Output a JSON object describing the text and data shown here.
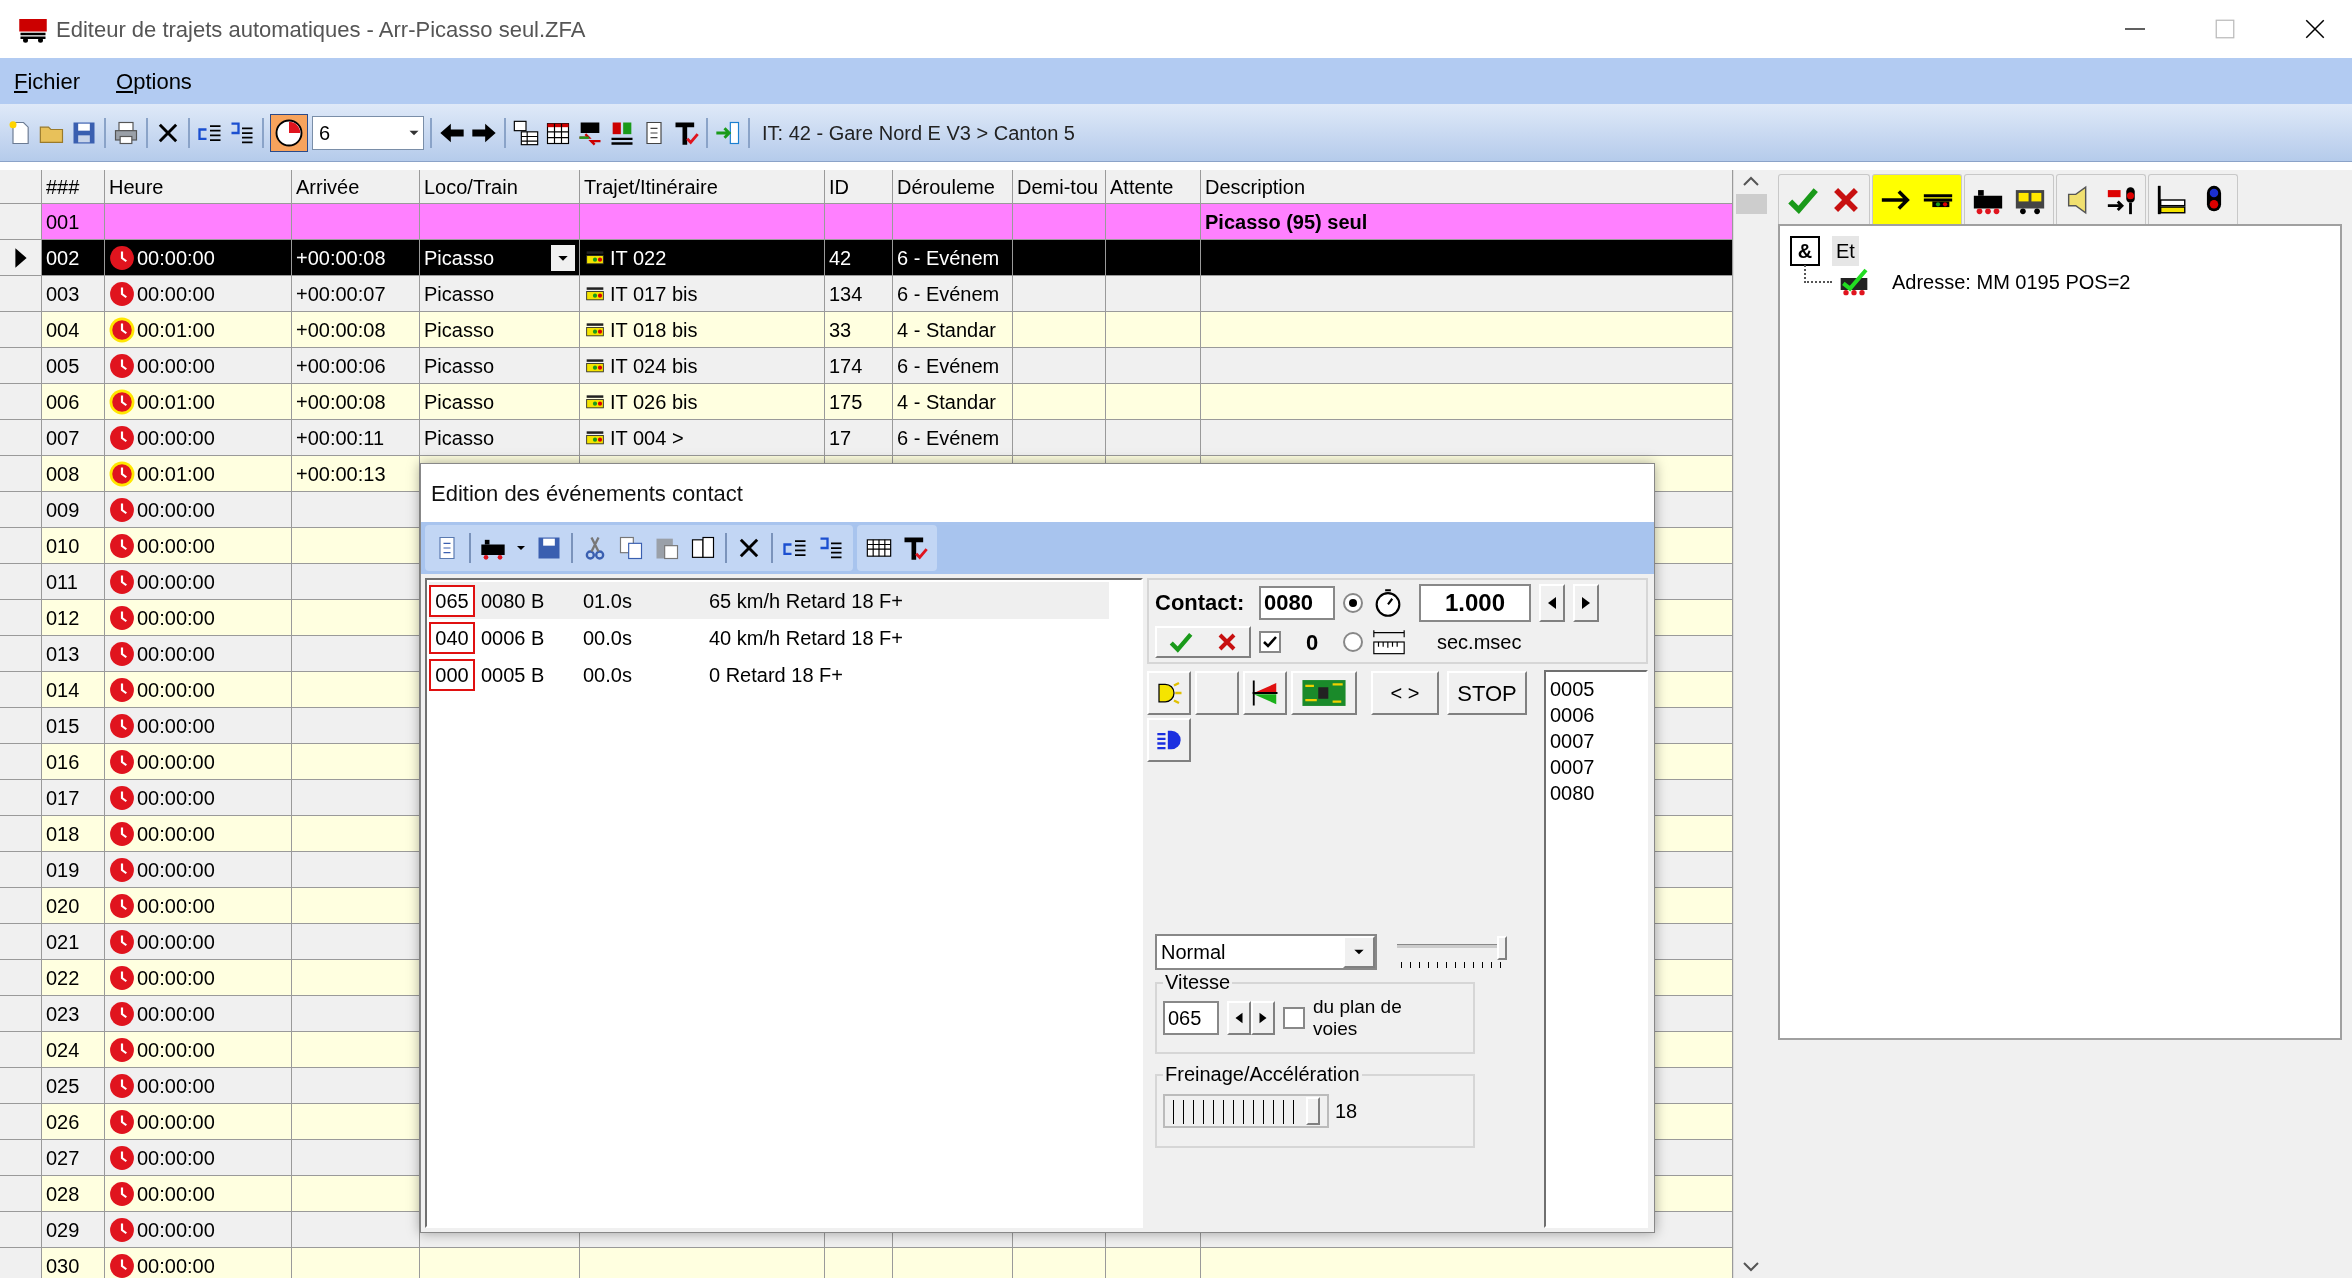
{
  "window": {
    "title": "Editeur de trajets automatiques - Arr-Picasso seul.ZFA"
  },
  "menu": [
    "Fichier",
    "Options"
  ],
  "toolbar": {
    "clock_button": {
      "on": true
    },
    "combo_value": "6",
    "status": "IT: 42 - Gare Nord E V3 > Canton 5"
  },
  "table": {
    "columns": [
      "###",
      "Heure",
      "Arrivée",
      "Loco/Train",
      "Trajet/Itinéraire",
      "ID",
      "Dérouleme",
      "Demi-tou",
      "Attente",
      "Description"
    ],
    "rows": [
      {
        "kind": "group",
        "num": "001",
        "description": "Picasso (95) seul",
        "selected": false
      },
      {
        "kind": "entry",
        "num": "002",
        "heure": "00:00:00",
        "arrivee": "+00:00:08",
        "loco": "Picasso",
        "trajet": "IT 022",
        "id": "42",
        "deroulement": "6 - Evénem",
        "selected": true,
        "highlighted": false
      },
      {
        "kind": "entry",
        "num": "003",
        "heure": "00:00:00",
        "arrivee": "+00:00:07",
        "loco": "Picasso",
        "trajet": "IT 017 bis",
        "id": "134",
        "deroulement": "6 - Evénem",
        "selected": false,
        "highlighted": false
      },
      {
        "kind": "entry",
        "num": "004",
        "heure": "00:01:00",
        "arrivee": "+00:00:08",
        "loco": "Picasso",
        "trajet": "IT 018 bis",
        "id": "33",
        "deroulement": "4 - Standar",
        "selected": false,
        "highlighted": true
      },
      {
        "kind": "entry",
        "num": "005",
        "heure": "00:00:00",
        "arrivee": "+00:00:06",
        "loco": "Picasso",
        "trajet": "IT 024 bis",
        "id": "174",
        "deroulement": "6 - Evénem",
        "selected": false,
        "highlighted": false
      },
      {
        "kind": "entry",
        "num": "006",
        "heure": "00:01:00",
        "arrivee": "+00:00:08",
        "loco": "Picasso",
        "trajet": "IT 026 bis",
        "id": "175",
        "deroulement": "4 - Standar",
        "selected": false,
        "highlighted": true
      },
      {
        "kind": "entry",
        "num": "007",
        "heure": "00:00:00",
        "arrivee": "+00:00:11",
        "loco": "Picasso",
        "trajet": "IT 004 >",
        "id": "17",
        "deroulement": "6 - Evénem",
        "selected": false,
        "highlighted": false
      },
      {
        "kind": "entry",
        "num": "008",
        "heure": "00:01:00",
        "arrivee": "+00:00:13",
        "selected": false,
        "highlighted": true
      },
      {
        "kind": "entry",
        "num": "009",
        "heure": "00:00:00",
        "selected": false,
        "highlighted": false
      },
      {
        "kind": "entry",
        "num": "010",
        "heure": "00:00:00",
        "selected": false,
        "highlighted": false
      },
      {
        "kind": "entry",
        "num": "011",
        "heure": "00:00:00",
        "selected": false,
        "highlighted": false
      },
      {
        "kind": "entry",
        "num": "012",
        "heure": "00:00:00",
        "selected": false,
        "highlighted": false
      },
      {
        "kind": "entry",
        "num": "013",
        "heure": "00:00:00",
        "selected": false,
        "highlighted": false
      },
      {
        "kind": "entry",
        "num": "014",
        "heure": "00:00:00",
        "selected": false,
        "highlighted": false
      },
      {
        "kind": "entry",
        "num": "015",
        "heure": "00:00:00",
        "selected": false,
        "highlighted": false
      },
      {
        "kind": "entry",
        "num": "016",
        "heure": "00:00:00",
        "selected": false,
        "highlighted": false
      },
      {
        "kind": "entry",
        "num": "017",
        "heure": "00:00:00",
        "selected": false,
        "highlighted": false
      },
      {
        "kind": "entry",
        "num": "018",
        "heure": "00:00:00",
        "selected": false,
        "highlighted": false
      },
      {
        "kind": "entry",
        "num": "019",
        "heure": "00:00:00",
        "selected": false,
        "highlighted": false
      },
      {
        "kind": "entry",
        "num": "020",
        "heure": "00:00:00",
        "selected": false,
        "highlighted": false
      },
      {
        "kind": "entry",
        "num": "021",
        "heure": "00:00:00",
        "selected": false,
        "highlighted": false
      },
      {
        "kind": "entry",
        "num": "022",
        "heure": "00:00:00",
        "selected": false,
        "highlighted": false
      },
      {
        "kind": "entry",
        "num": "023",
        "heure": "00:00:00",
        "selected": false,
        "highlighted": false
      },
      {
        "kind": "entry",
        "num": "024",
        "heure": "00:00:00",
        "selected": false,
        "highlighted": false
      },
      {
        "kind": "entry",
        "num": "025",
        "heure": "00:00:00",
        "selected": false,
        "highlighted": false
      },
      {
        "kind": "entry",
        "num": "026",
        "heure": "00:00:00",
        "selected": false,
        "highlighted": false
      },
      {
        "kind": "entry",
        "num": "027",
        "heure": "00:00:00",
        "selected": false,
        "highlighted": false
      },
      {
        "kind": "entry",
        "num": "028",
        "heure": "00:00:00",
        "selected": false,
        "highlighted": false
      },
      {
        "kind": "entry",
        "num": "029",
        "heure": "00:00:00",
        "selected": false,
        "highlighted": false
      },
      {
        "kind": "entry",
        "num": "030",
        "heure": "00:00:00",
        "selected": false,
        "highlighted": false
      }
    ]
  },
  "tool_tabs": [
    {
      "selected": false
    },
    {
      "selected": true
    },
    {
      "selected": false
    },
    {
      "selected": false
    },
    {
      "selected": false
    }
  ],
  "tree": [
    {
      "symbol": "&",
      "label": "Et",
      "selected": true,
      "children": [
        {
          "label": "Adresse: MM 0195 POS=2"
        }
      ]
    }
  ],
  "dialog": {
    "title": "Edition des événements contact",
    "events": [
      {
        "code": "065",
        "contact": "0080 B",
        "time": "01.0s",
        "text": "65 km/h Retard 18 F+",
        "selected": true
      },
      {
        "code": "040",
        "contact": "0006 B",
        "time": "00.0s",
        "text": "40 km/h Retard 18 F+",
        "selected": false
      },
      {
        "code": "000",
        "contact": "0005 B",
        "time": "00.0s",
        "text": "0 Retard 18 F+",
        "selected": false
      }
    ],
    "contact_label": "Contact:",
    "contact": "0080",
    "radios": [
      {
        "selected": true
      },
      {
        "selected": false
      }
    ],
    "duration": "1.000",
    "unit": "sec.msec",
    "check": {
      "checked": true,
      "label": "0"
    },
    "buttons": [
      "< >",
      "STOP"
    ],
    "contacts": [
      "0005",
      "0006",
      "0007",
      "0007",
      "0080"
    ],
    "mode": "Normal",
    "mode_slider": {
      "level": 1
    },
    "vitesse": {
      "legend": "Vitesse",
      "value": "065",
      "checked": false,
      "label": "du plan de voies"
    },
    "freinage": {
      "legend": "Freinage/Accélération",
      "level": 0.95,
      "reading": "18"
    }
  }
}
